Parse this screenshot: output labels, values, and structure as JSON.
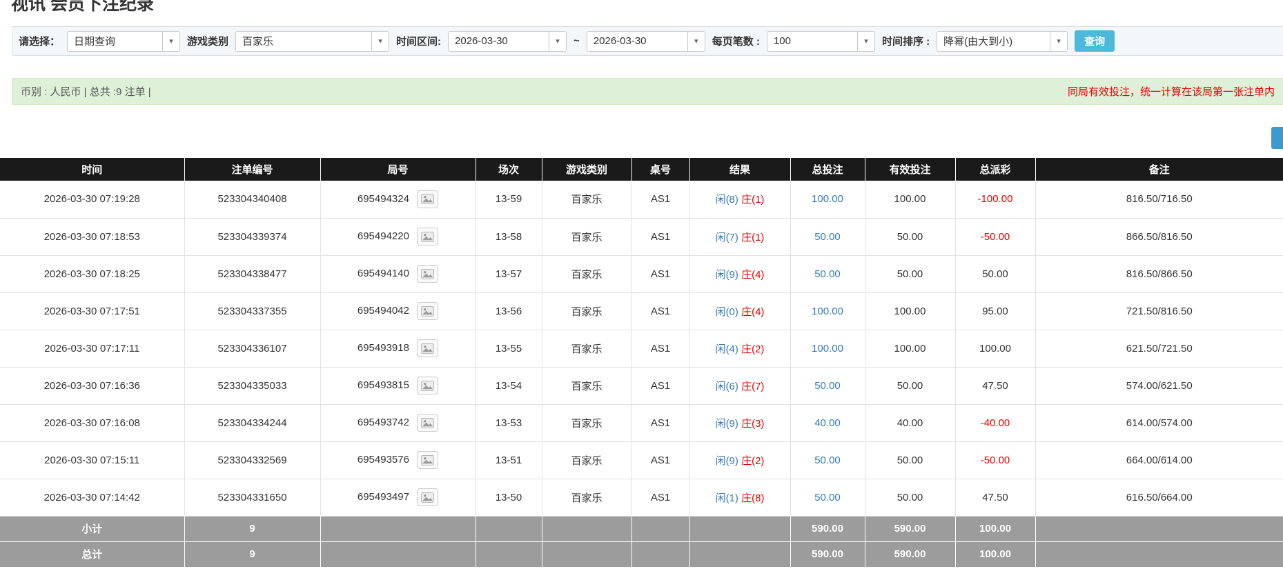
{
  "page": {
    "title": "视讯 会员下注纪录"
  },
  "filters": {
    "select_label": "请选择：",
    "select_value": "日期查询",
    "game_type_label": "游戏类别",
    "game_type_value": "百家乐",
    "time_range_label": "时间区间:",
    "time_from": "2026-03-30",
    "range_separator": "~",
    "time_to": "2026-03-30",
    "page_size_label": "每页笔数 :",
    "page_size_value": "100",
    "sort_label": "时间排序 :",
    "sort_value": "降幂(由大到小)",
    "search_button": "查询"
  },
  "summary": {
    "left": "币别 : 人民币 | 总共 :9 注单 |",
    "right": "同局有效投注，统一计算在该局第一张注单内"
  },
  "icons": {
    "chevron_down": "▾"
  },
  "colors": {
    "header_bg": "#1a1a1a",
    "footer_bg": "#9c9c9c",
    "link_blue": "#337ab7",
    "player_blue": "#337ab7",
    "banker_red": "#e00000",
    "negative_red": "#e60000",
    "search_button_cyan": "#4cb9db",
    "alert_green_bg": "#dff0d8",
    "clipped_button_blue": "#3d9ad1"
  },
  "table": {
    "headers": [
      "时间",
      "注单编号",
      "局号",
      "场次",
      "游戏类别",
      "桌号",
      "结果",
      "总投注",
      "有效投注",
      "总派彩",
      "备注"
    ],
    "rows": [
      {
        "time": "2026-03-30 07:19:28",
        "bet_id": "523304340408",
        "round": "695494324",
        "session": "13-59",
        "game": "百家乐",
        "table_no": "AS1",
        "result_player": "闲(8)",
        "result_banker": "庄(1)",
        "total_bet": "100.00",
        "valid_bet": "100.00",
        "payout": "-100.00",
        "note": "816.50/716.50"
      },
      {
        "time": "2026-03-30 07:18:53",
        "bet_id": "523304339374",
        "round": "695494220",
        "session": "13-58",
        "game": "百家乐",
        "table_no": "AS1",
        "result_player": "闲(7)",
        "result_banker": "庄(1)",
        "total_bet": "50.00",
        "valid_bet": "50.00",
        "payout": "-50.00",
        "note": "866.50/816.50"
      },
      {
        "time": "2026-03-30 07:18:25",
        "bet_id": "523304338477",
        "round": "695494140",
        "session": "13-57",
        "game": "百家乐",
        "table_no": "AS1",
        "result_player": "闲(9)",
        "result_banker": "庄(4)",
        "total_bet": "50.00",
        "valid_bet": "50.00",
        "payout": "50.00",
        "note": "816.50/866.50"
      },
      {
        "time": "2026-03-30 07:17:51",
        "bet_id": "523304337355",
        "round": "695494042",
        "session": "13-56",
        "game": "百家乐",
        "table_no": "AS1",
        "result_player": "闲(0)",
        "result_banker": "庄(4)",
        "total_bet": "100.00",
        "valid_bet": "100.00",
        "payout": "95.00",
        "note": "721.50/816.50"
      },
      {
        "time": "2026-03-30 07:17:11",
        "bet_id": "523304336107",
        "round": "695493918",
        "session": "13-55",
        "game": "百家乐",
        "table_no": "AS1",
        "result_player": "闲(4)",
        "result_banker": "庄(2)",
        "total_bet": "100.00",
        "valid_bet": "100.00",
        "payout": "100.00",
        "note": "621.50/721.50"
      },
      {
        "time": "2026-03-30 07:16:36",
        "bet_id": "523304335033",
        "round": "695493815",
        "session": "13-54",
        "game": "百家乐",
        "table_no": "AS1",
        "result_player": "闲(6)",
        "result_banker": "庄(7)",
        "total_bet": "50.00",
        "valid_bet": "50.00",
        "payout": "47.50",
        "note": "574.00/621.50"
      },
      {
        "time": "2026-03-30 07:16:08",
        "bet_id": "523304334244",
        "round": "695493742",
        "session": "13-53",
        "game": "百家乐",
        "table_no": "AS1",
        "result_player": "闲(9)",
        "result_banker": "庄(3)",
        "total_bet": "40.00",
        "valid_bet": "40.00",
        "payout": "-40.00",
        "note": "614.00/574.00"
      },
      {
        "time": "2026-03-30 07:15:11",
        "bet_id": "523304332569",
        "round": "695493576",
        "session": "13-51",
        "game": "百家乐",
        "table_no": "AS1",
        "result_player": "闲(9)",
        "result_banker": "庄(2)",
        "total_bet": "50.00",
        "valid_bet": "50.00",
        "payout": "-50.00",
        "note": "664.00/614.00"
      },
      {
        "time": "2026-03-30 07:14:42",
        "bet_id": "523304331650",
        "round": "695493497",
        "session": "13-50",
        "game": "百家乐",
        "table_no": "AS1",
        "result_player": "闲(1)",
        "result_banker": "庄(8)",
        "total_bet": "50.00",
        "valid_bet": "50.00",
        "payout": "47.50",
        "note": "616.50/664.00"
      }
    ],
    "subtotal": {
      "label": "小计",
      "count": "9",
      "total_bet": "590.00",
      "valid_bet": "590.00",
      "payout": "100.00"
    },
    "total": {
      "label": "总计",
      "count": "9",
      "total_bet": "590.00",
      "valid_bet": "590.00",
      "payout": "100.00"
    }
  }
}
